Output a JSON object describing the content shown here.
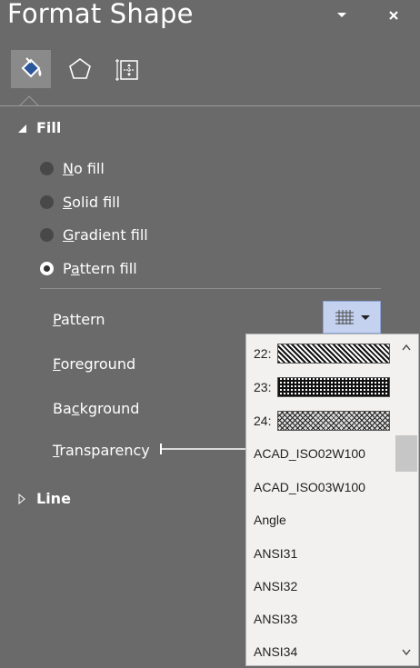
{
  "title": "Format Shape",
  "tabs": [
    {
      "name": "Fill & Line",
      "icon": "paint-bucket-icon",
      "active": true
    },
    {
      "name": "Effects",
      "icon": "pentagon-icon",
      "active": false
    },
    {
      "name": "Size & Properties",
      "icon": "size-properties-icon",
      "active": false
    }
  ],
  "fill": {
    "header": "Fill",
    "options": [
      {
        "pre": "",
        "key": "N",
        "post": "o fill",
        "checked": false
      },
      {
        "pre": "",
        "key": "S",
        "post": "olid fill",
        "checked": false
      },
      {
        "pre": "",
        "key": "G",
        "post": "radient fill",
        "checked": false
      },
      {
        "pre": "P",
        "key": "a",
        "post": "ttern fill",
        "checked": true
      }
    ],
    "pattern": {
      "pre": "",
      "key": "P",
      "post": "attern"
    },
    "foreground": {
      "pre": "",
      "key": "F",
      "post": "oreground"
    },
    "background": {
      "pre": "Ba",
      "key": "c",
      "post": "kground"
    },
    "transparency": {
      "pre": "",
      "key": "T",
      "post": "ransparency"
    }
  },
  "line": {
    "header": "Line"
  },
  "pattern_list": {
    "items": [
      {
        "label": "22:"
      },
      {
        "label": "23:"
      },
      {
        "label": "24:"
      },
      {
        "label": "ACAD_ISO02W100"
      },
      {
        "label": "ACAD_ISO03W100"
      },
      {
        "label": "Angle"
      },
      {
        "label": "ANSI31"
      },
      {
        "label": "ANSI32"
      },
      {
        "label": "ANSI33"
      },
      {
        "label": "ANSI34"
      }
    ]
  },
  "colors": {
    "pane_bg": "#6a6a6a",
    "active_tab_bg": "#8a8a8a",
    "accent": "#2b579a",
    "pattern_button_bg": "#c4d2f0"
  }
}
